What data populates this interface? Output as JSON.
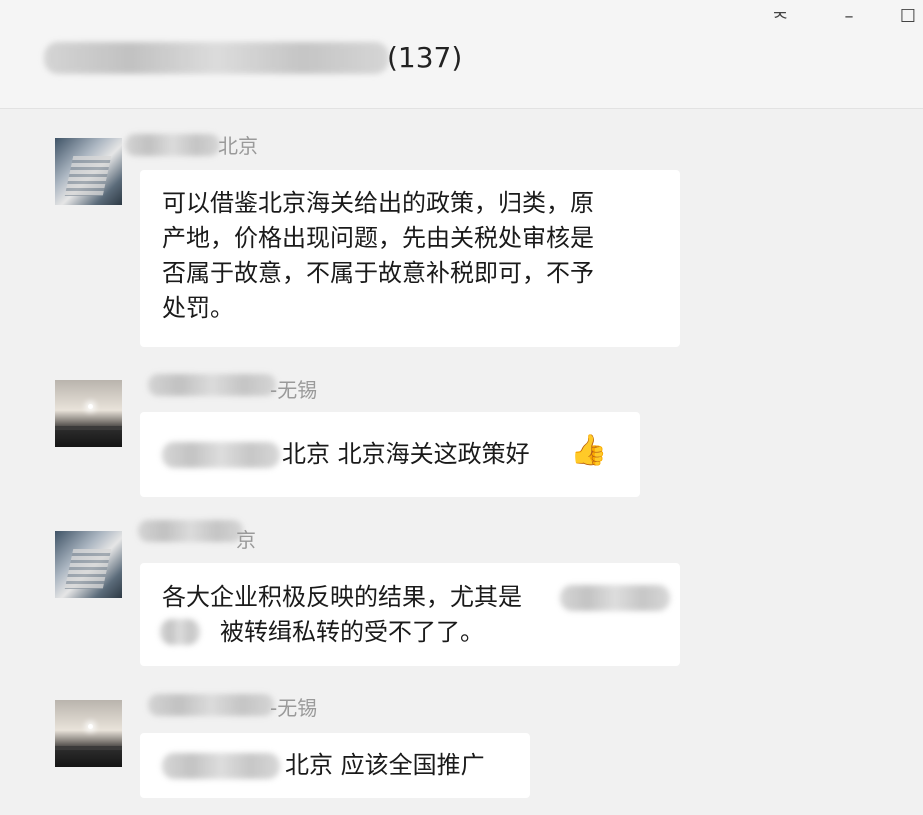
{
  "window": {
    "title_count": "(137)",
    "controls": {
      "pin_icon": "pin-icon",
      "pin_glyph": "ᅐ",
      "minimize_icon": "minimize-icon",
      "minimize_glyph": "–",
      "maximize_icon": "maximize-icon",
      "maximize_glyph": "☐"
    }
  },
  "messages": [
    {
      "sender_suffix": "北京",
      "avatar": "city-avatar",
      "lines": [
        "可以借鉴北京海关给出的政策，归类，原",
        "产地，价格出现问题，先由关税处审核是",
        "否属于故意，不属于故意补税即可，不予",
        "处罚。"
      ]
    },
    {
      "sender_suffix": "-无锡",
      "avatar": "sea-avatar",
      "text": "北京 北京海关这政策好",
      "emoji": "👍"
    },
    {
      "sender_suffix": "京",
      "avatar": "city-avatar",
      "line1": "各大企业积极反映的结果，尤其是",
      "line2": "被转缉私转的受不了了。"
    },
    {
      "sender_suffix": "-无锡",
      "avatar": "sea-avatar",
      "text": "北京 应该全国推广"
    }
  ]
}
